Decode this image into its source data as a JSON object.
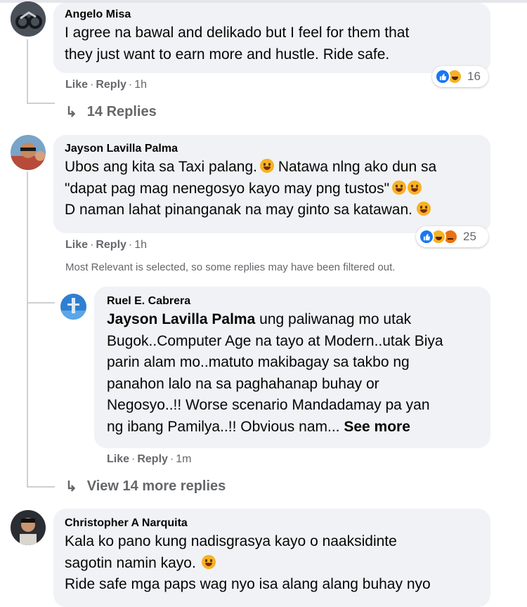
{
  "comments": [
    {
      "author": "Angelo Misa",
      "lines": [
        "I agree na bawal and delikado but I feel for them that",
        "they just want to earn more and hustle. Ride safe."
      ],
      "like_label": "Like",
      "reply_label": "Reply",
      "time": "1h",
      "reaction_count": "16",
      "reactions": [
        "like",
        "haha"
      ],
      "replies_label": "14 Replies"
    },
    {
      "author": "Jayson Lavilla Palma",
      "lines": [
        "Ubos ang kita sa Taxi palang.",
        "Natawa nlng ako dun sa",
        "\"dapat pag mag nenegosyo kayo may png tustos\"",
        "D naman lahat pinanganak na may ginto sa katawan."
      ],
      "like_label": "Like",
      "reply_label": "Reply",
      "time": "1h",
      "reaction_count": "25",
      "reactions": [
        "like",
        "haha",
        "angry"
      ],
      "filter_note": "Most Relevant is selected, so some replies may have been filtered out."
    },
    {
      "author": "Christopher A Narquita",
      "lines": [
        "Kala ko pano kung nadisgrasya kayo o naaksidinte",
        "sagotin namin kayo.",
        "Ride safe mga paps wag nyo isa alang alang buhay nyo"
      ]
    }
  ],
  "reply": {
    "author": "Ruel E. Cabrera",
    "mention": "Jayson Lavilla Palma",
    "lines": [
      "ung paliwanag mo utak",
      "Bugok..Computer Age na tayo at Modern..utak Biya",
      "parin alam mo..matuto makibagay sa takbo ng",
      "panahon lalo na sa paghahanap buhay or",
      "Negosyo..!! Worse scenario Mandadamay pa yan",
      "ng ibang Pamilya..!! Obvious nam..."
    ],
    "see_more": "See more",
    "like_label": "Like",
    "reply_label": "Reply",
    "time": "1m",
    "more_replies_label": "View 14 more replies"
  },
  "icons": {
    "reply_arrow": "↳",
    "dot": "·"
  }
}
